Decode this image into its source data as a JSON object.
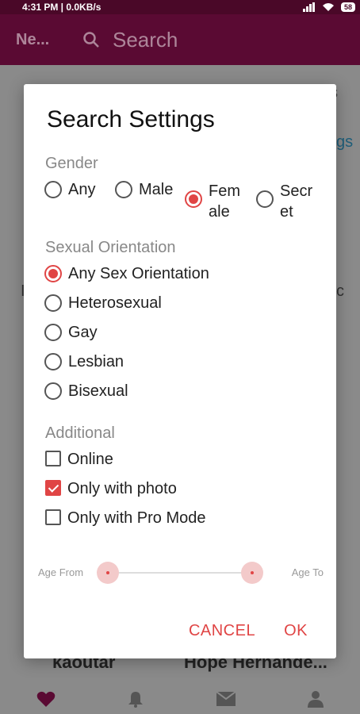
{
  "status_bar": {
    "time": "4:31 PM | 0.0KB/s",
    "battery": "58"
  },
  "app_bar": {
    "title": "Ne...",
    "search_placeholder": "Search"
  },
  "background": {
    "fragment_right_top": "s",
    "fragment_link": "gs",
    "fragment_left_mid": "I",
    "fragment_right_mid": "c",
    "name_left": "kaoutar",
    "name_right": "Hope Hernande..."
  },
  "dialog": {
    "title": "Search Settings",
    "gender": {
      "label": "Gender",
      "options": [
        {
          "label": "Any",
          "selected": false
        },
        {
          "label": "Male",
          "selected": false
        },
        {
          "label": "Fem ale",
          "selected": true
        },
        {
          "label": "Secr et",
          "selected": false
        }
      ]
    },
    "orientation": {
      "label": "Sexual Orientation",
      "options": [
        {
          "label": "Any Sex Orientation",
          "selected": true
        },
        {
          "label": "Heterosexual",
          "selected": false
        },
        {
          "label": "Gay",
          "selected": false
        },
        {
          "label": "Lesbian",
          "selected": false
        },
        {
          "label": "Bisexual",
          "selected": false
        }
      ]
    },
    "additional": {
      "label": "Additional",
      "options": [
        {
          "label": "Online",
          "checked": false
        },
        {
          "label": "Only with photo",
          "checked": true
        },
        {
          "label": "Only with Pro Mode",
          "checked": false
        }
      ]
    },
    "age": {
      "from_label": "Age From",
      "to_label": "Age To"
    },
    "cancel_label": "CANCEL",
    "ok_label": "OK"
  },
  "colors": {
    "accent": "#e04545",
    "app_bar": "#5a0a33"
  }
}
